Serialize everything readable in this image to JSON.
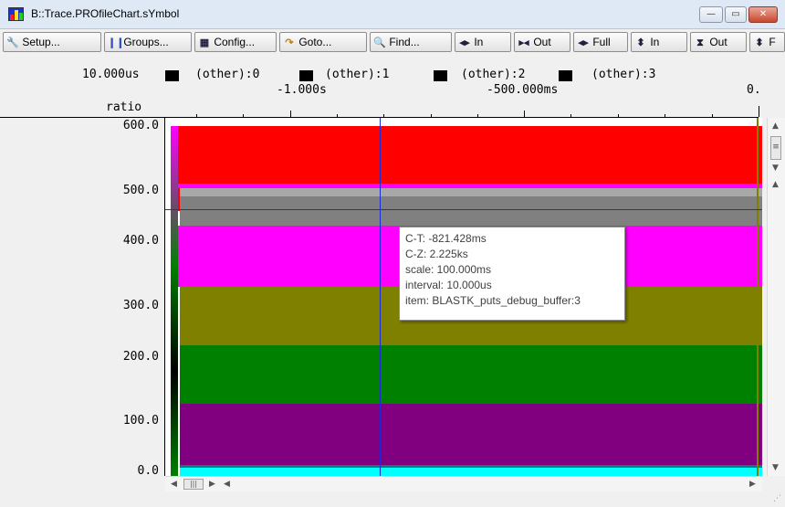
{
  "window": {
    "title": "B::Trace.PROfileChart.sYmbol",
    "minimize_glyph": "—",
    "maximize_glyph": "▭",
    "close_glyph": "✕"
  },
  "toolbar": {
    "setup": "Setup...",
    "groups": "Groups...",
    "config": "Config...",
    "goto": "Goto...",
    "find": "Find...",
    "zoom_in": "In",
    "zoom_out": "Out",
    "full": "Full",
    "vzoom_in": "In",
    "vzoom_out": "Out",
    "last_partial": "F"
  },
  "header": {
    "interval": "10.000us",
    "legend": [
      {
        "label": "(other):0",
        "color": "#000000"
      },
      {
        "label": "(other):1",
        "color": "#000000"
      },
      {
        "label": "(other):2",
        "color": "#000000"
      },
      {
        "label": "(other):3",
        "color": "#000000"
      }
    ],
    "ticks": [
      "-1.000s",
      "-500.000ms",
      "0."
    ],
    "y_title": "ratio"
  },
  "y_axis": [
    "600.0",
    "500.0",
    "400.0",
    "300.0",
    "200.0",
    "100.0",
    "0.0"
  ],
  "tooltip": {
    "ct": "C-T: -821.428ms",
    "cz": "C-Z:  2.225ks",
    "scale": "scale: 100.000ms",
    "interval": "interval:  10.000us",
    "item": "item: BLASTK_puts_debug_buffer:3"
  },
  "colors": {
    "red": "#ff0000",
    "magenta": "#ff00ff",
    "gray": "#808080",
    "olive": "#808000",
    "green": "#008000",
    "purple": "#800080",
    "cyan": "#00ffff",
    "cursor": "#1d2bd6"
  }
}
